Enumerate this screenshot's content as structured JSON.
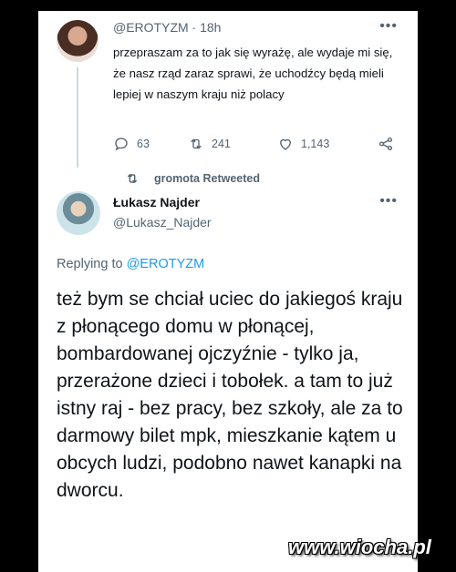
{
  "original_tweet": {
    "handle": "@EROTYZM",
    "time": "18h",
    "text": "przepraszam za to jak się wyrażę, ale wydaje mi się, że nasz rząd zaraz sprawi, że uchodźcy będą mieli lepiej w naszym kraju niż polacy",
    "replies": "63",
    "retweets": "241",
    "likes": "1,143"
  },
  "retweet_banner": "gromota Retweeted",
  "reply_tweet": {
    "name": "Łukasz Najder",
    "handle": "@Lukasz_Najder",
    "replying_prefix": "Replying to",
    "replying_to": "@EROTYZM",
    "text": "też bym se chciał uciec do jakiegoś kraju z płonącego domu w płonącej, bombardowanej ojczyźnie - tylko ja, przerażone dzieci i tobołek. a tam to już istny raj - bez pracy, bez szkoły, ale za to darmowy bilet mpk, mieszkanie kątem u obcych ludzi, podobno nawet kanapki na dworcu."
  },
  "watermark": "www.wiocha.pl",
  "colors": {
    "accent": "#1d9bf0",
    "muted": "#536471",
    "text": "#0f1419"
  }
}
